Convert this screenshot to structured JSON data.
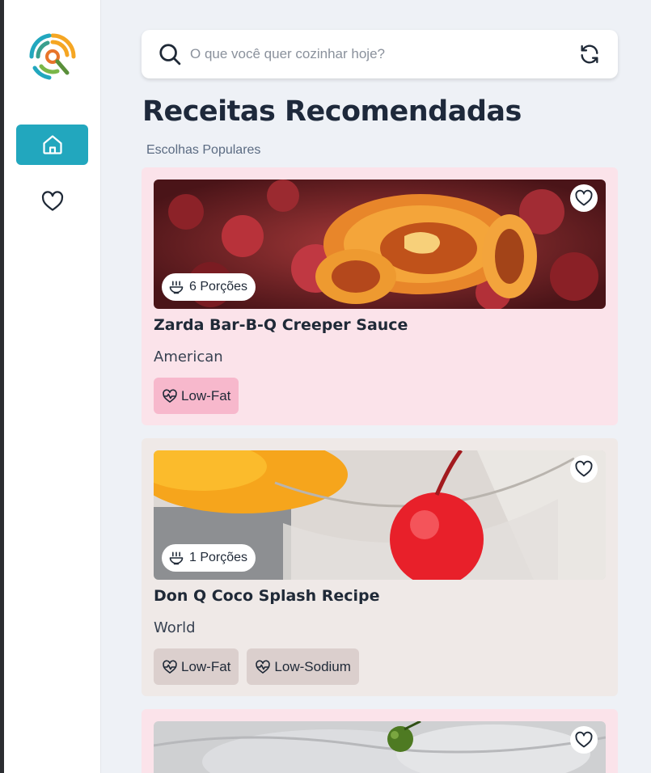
{
  "app": {
    "logo_icon": "spiral-search-logo-icon"
  },
  "sidebar": {
    "items": [
      {
        "name": "home",
        "icon": "home-icon",
        "active": true
      },
      {
        "name": "favorites",
        "icon": "heart-icon",
        "active": false
      }
    ],
    "active_color": "#22a7be"
  },
  "search": {
    "placeholder": "O que você quer cozinhar hoje?",
    "value": "",
    "search_icon": "search-icon",
    "refresh_icon": "refresh-icon"
  },
  "main": {
    "title": "Receitas Recomendadas",
    "subtitle": "Escolhas Populares"
  },
  "recipes": [
    {
      "name": "Zarda Bar-B-Q Creeper Sauce",
      "cuisine": "American",
      "servings": "6 Porções",
      "tags": [
        "Low-Fat"
      ],
      "card_color": "#fbe3ea",
      "tag_color": "#f7b8cc"
    },
    {
      "name": "Don Q Coco Splash Recipe",
      "cuisine": "World",
      "servings": "1 Porções",
      "tags": [
        "Low-Fat",
        "Low-Sodium"
      ],
      "card_color": "#efe9e7",
      "tag_color": "#dbcfcd"
    },
    {
      "card_color": "#fbe3ea"
    }
  ]
}
